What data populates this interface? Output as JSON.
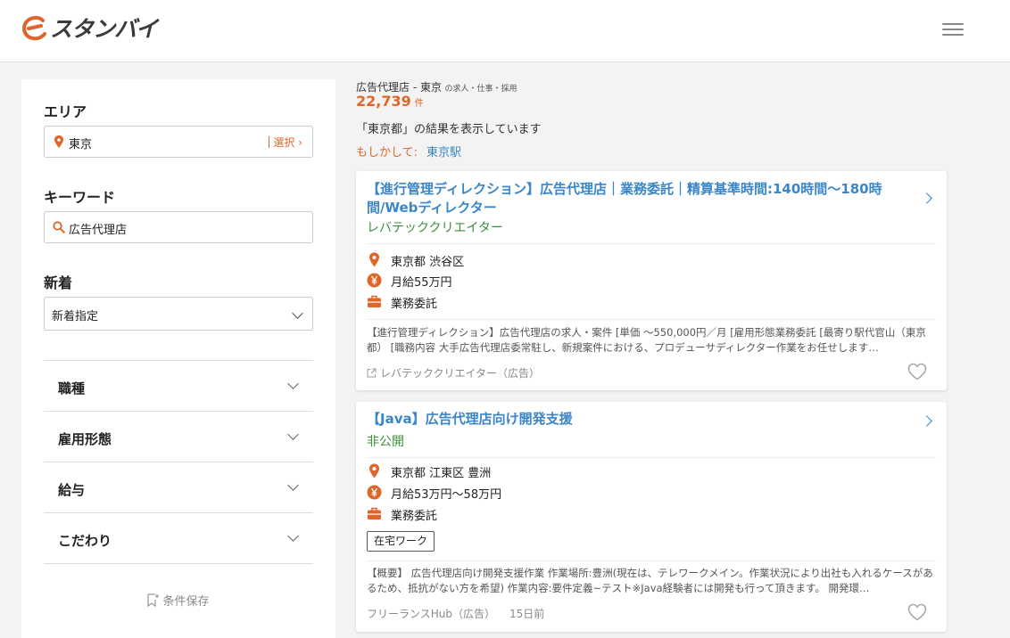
{
  "header": {
    "logo_text": "スタンバイ",
    "brand_color": "#e0652a"
  },
  "sidebar": {
    "area_label": "エリア",
    "area_value": "東京",
    "area_select": "選択",
    "keyword_label": "キーワード",
    "keyword_value": "広告代理店",
    "new_label": "新着",
    "new_value": "新着指定",
    "accordion": [
      "職種",
      "雇用形態",
      "給与",
      "こだわり"
    ],
    "save_label": "条件保存"
  },
  "results": {
    "title_main": "広告代理店 - 東京",
    "title_suffix": "の求人・仕事・採用",
    "count": "22,739",
    "count_unit": "件",
    "showing": "「東京都」の結果を表示しています",
    "suggest_label": "もしかして:",
    "suggest_link": "東京駅"
  },
  "jobs": [
    {
      "title": "【進行管理ディレクション】広告代理店｜業務委託｜精算基準時間:140時間～180時間/Webディレクター",
      "company": "レバテッククリエイター",
      "location": "東京都 渋谷区",
      "salary": "月給55万円",
      "employment": "業務委託",
      "description": "【進行管理ディレクション】広告代理店の求人・案件 [単価 ～550,000円／月 [雇用形態業務委託 [最寄り駅代官山（東京都） [職務内容 大手広告代理店委常駐し、新規案件における、プロデューサディレクター作業をお任せします…",
      "source": "レバテッククリエイター（広告）"
    },
    {
      "title": "【Java】広告代理店向け開発支援",
      "company": "非公開",
      "location": "東京都 江東区 豊洲",
      "salary": "月給53万円～58万円",
      "employment": "業務委託",
      "tag": "在宅ワーク",
      "description": "【概要】 広告代理店向け開発支援作業 作業場所:豊洲(現在は、テレワークメイン。作業状況により出社も入れるケースがあるため、抵抗がない方を希望) 作業内容:要件定義~テスト※Java経験者には開発も行って頂きます。 開発環…",
      "source": "フリーランスHub（広告）",
      "age": "15日前"
    }
  ]
}
